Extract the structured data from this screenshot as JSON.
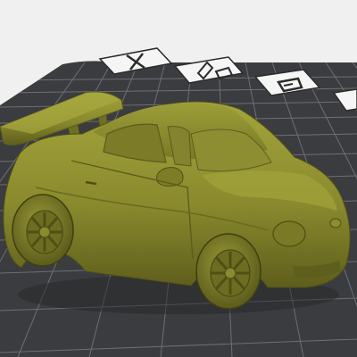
{
  "viewport": {
    "background": "#f0f0f0",
    "bed_color": "#3b3c3f",
    "grid_color": "#6b6c70",
    "model_color": "#8a8a2e"
  },
  "bed_markers": [
    {
      "icon": "close-x-icon"
    },
    {
      "icon": "pen-tool-icon"
    },
    {
      "icon": "gcode-logo-icon"
    },
    {
      "icon": "partial-marker-icon"
    }
  ],
  "model": {
    "icon": "sports-car-model"
  }
}
